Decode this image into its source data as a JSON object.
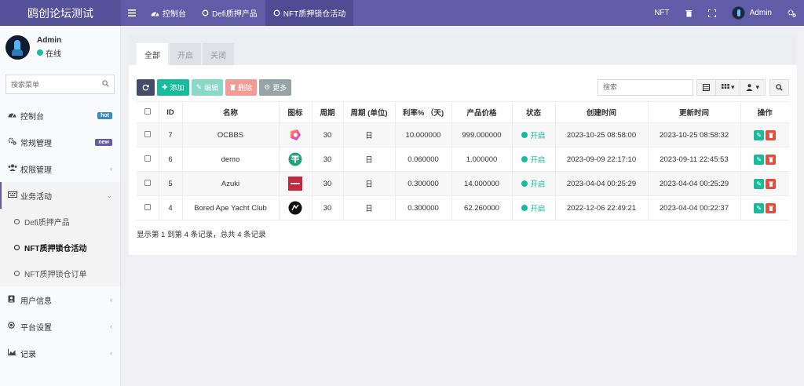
{
  "brand": "鸥创论坛测试",
  "topnav": [
    {
      "label": "控制台"
    },
    {
      "label": "Defi质押产品"
    },
    {
      "label": "NFT质押锁仓活动"
    }
  ],
  "topright": {
    "nft": "NFT",
    "admin": "Admin"
  },
  "user": {
    "name": "Admin",
    "status": "在线"
  },
  "sidebar": {
    "search_placeholder": "搜索菜单",
    "items": [
      {
        "label": "控制台",
        "badge": "hot"
      },
      {
        "label": "常规管理",
        "badge": "new"
      },
      {
        "label": "权限管理"
      },
      {
        "label": "业务活动"
      },
      {
        "label": "用户信息"
      },
      {
        "label": "平台设置"
      },
      {
        "label": "记录"
      }
    ],
    "submenu": [
      {
        "label": "Defi质押产品"
      },
      {
        "label": "NFT质押锁仓活动"
      },
      {
        "label": "NFT质押锁仓订单"
      }
    ]
  },
  "tabs": [
    "全部",
    "开启",
    "关闭"
  ],
  "toolbar": {
    "add": "添加",
    "edit": "编辑",
    "delete": "删除",
    "more": "更多",
    "search_placeholder": "搜索"
  },
  "table": {
    "headers": [
      "ID",
      "名称",
      "图标",
      "周期",
      "周期 (单位)",
      "利率% （天)",
      "产品价格",
      "状态",
      "创建时间",
      "更新时间",
      "操作"
    ],
    "rows": [
      {
        "id": "7",
        "name": "OCBBS",
        "icon": "ocbbs-logo-icon",
        "period": "30",
        "unit": "日",
        "rate": "10.000000",
        "price": "999.000000",
        "status": "开启",
        "created": "2023-10-25 08:58:00",
        "updated": "2023-10-25 08:58:32"
      },
      {
        "id": "6",
        "name": "demo",
        "icon": "tether-logo-icon",
        "period": "30",
        "unit": "日",
        "rate": "0.060000",
        "price": "1.000000",
        "status": "开启",
        "created": "2023-09-09 22:17:10",
        "updated": "2023-09-11 22:45:53"
      },
      {
        "id": "5",
        "name": "Azuki",
        "icon": "azuki-logo-icon",
        "period": "30",
        "unit": "日",
        "rate": "0.300000",
        "price": "14.000000",
        "status": "开启",
        "created": "2023-04-04 00:25:29",
        "updated": "2023-04-04 00:25:29"
      },
      {
        "id": "4",
        "name": "Bored Ape Yacht Club",
        "icon": "bayc-logo-icon",
        "period": "30",
        "unit": "日",
        "rate": "0.300000",
        "price": "62.260000",
        "status": "开启",
        "created": "2022-12-06 22:49:21",
        "updated": "2023-04-04 00:22:37"
      }
    ]
  },
  "footer": "显示第 1 到第 4 条记录，总共 4 条记录",
  "colors": {
    "primary": "#605ca8",
    "success": "#18bc9c",
    "danger": "#e74c3c"
  }
}
